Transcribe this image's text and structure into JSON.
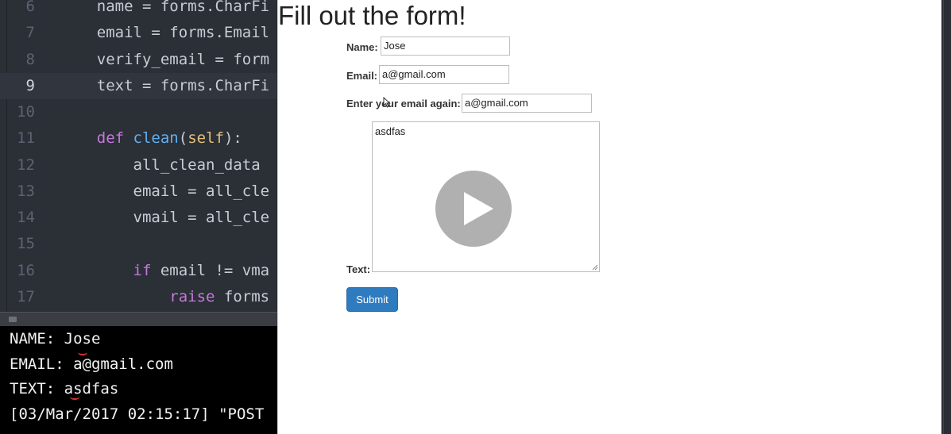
{
  "editor": {
    "lines": [
      {
        "num": "6",
        "parts": [
          {
            "t": "    name = forms.CharFi",
            "c": "p"
          }
        ]
      },
      {
        "num": "7",
        "parts": [
          {
            "t": "    email = forms.Email",
            "c": "p"
          }
        ]
      },
      {
        "num": "8",
        "parts": [
          {
            "t": "    verify_email = form",
            "c": "p"
          }
        ]
      },
      {
        "num": "9",
        "parts": [
          {
            "t": "    text = forms.CharFi",
            "c": "p"
          }
        ],
        "current": true
      },
      {
        "num": "10",
        "parts": []
      },
      {
        "num": "11",
        "parts": [
          {
            "t": "    ",
            "c": "p"
          },
          {
            "t": "def",
            "c": "k"
          },
          {
            "t": " ",
            "c": "p"
          },
          {
            "t": "clean",
            "c": "f"
          },
          {
            "t": "(",
            "c": "p"
          },
          {
            "t": "self",
            "c": "s"
          },
          {
            "t": "):",
            "c": "p"
          }
        ]
      },
      {
        "num": "12",
        "parts": [
          {
            "t": "        all_clean_data",
            "c": "p"
          }
        ]
      },
      {
        "num": "13",
        "parts": [
          {
            "t": "        email = all_cle",
            "c": "p"
          }
        ]
      },
      {
        "num": "14",
        "parts": [
          {
            "t": "        vmail = all_cle",
            "c": "p"
          }
        ]
      },
      {
        "num": "15",
        "parts": []
      },
      {
        "num": "16",
        "parts": [
          {
            "t": "        ",
            "c": "p"
          },
          {
            "t": "if",
            "c": "k"
          },
          {
            "t": " email != vma",
            "c": "p"
          }
        ]
      },
      {
        "num": "17",
        "parts": [
          {
            "t": "            ",
            "c": "p"
          },
          {
            "t": "raise",
            "c": "k"
          },
          {
            "t": " forms",
            "c": "p"
          }
        ]
      }
    ]
  },
  "terminal": {
    "lines": [
      "NAME: Jose",
      "EMAIL: a@gmail.com",
      "TEXT: asdfas",
      "[03/Mar/2017 02:15:17] \"POST"
    ]
  },
  "form": {
    "title": "Fill out the form!",
    "name_label": "Name:",
    "name_value": "Jose",
    "email_label": "Email:",
    "email_value": "a@gmail.com",
    "verify_label": "Enter your email again:",
    "verify_value": "a@gmail.com",
    "text_label": "Text:",
    "text_value": "asdfas",
    "submit_label": "Submit"
  },
  "colors": {
    "submit": "#2f7bbf",
    "editor_bg": "#2b2f36",
    "keyword": "#c678dd",
    "function": "#61afef"
  },
  "icons": {
    "overlay": "play-icon",
    "pointer": "cursor-icon"
  }
}
